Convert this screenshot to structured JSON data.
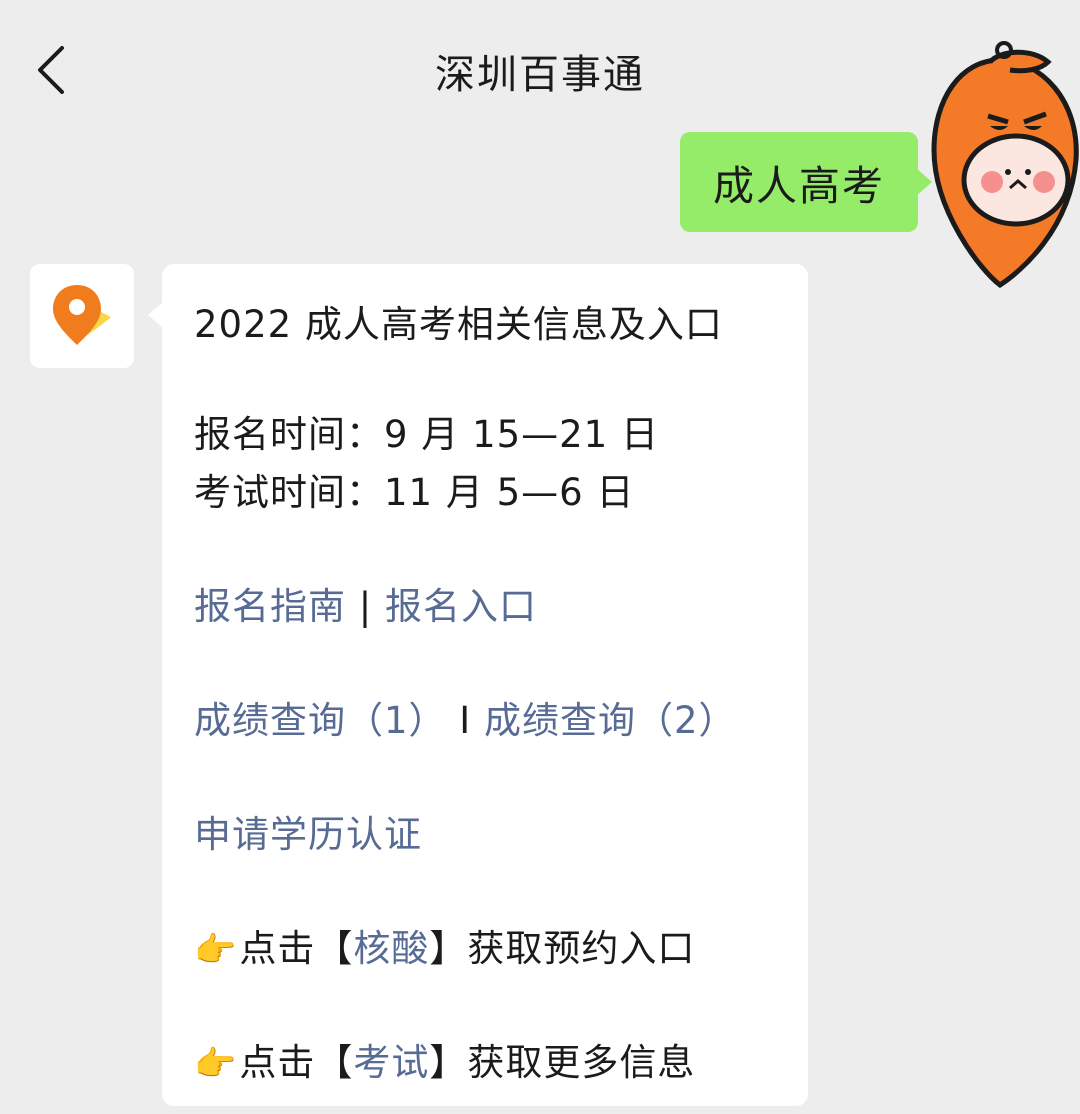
{
  "header": {
    "title": "深圳百事通"
  },
  "user_message": {
    "text": "成人高考"
  },
  "bot_message": {
    "headline": "2022 成人高考相关信息及入口",
    "registration_time": "报名时间：9 月 15—21 日",
    "exam_time": "考试时间：11 月 5—6 日",
    "links_row1": {
      "link1": "报名指南",
      "separator": " | ",
      "link2": "报名入口"
    },
    "links_row2": {
      "link1": "成绩查询（1）",
      "separator": " I ",
      "link2": "成绩查询（2）"
    },
    "links_row3": {
      "link1": "申请学历认证"
    },
    "promo1": {
      "emoji": "👉",
      "prefix": "点击【",
      "link": "核酸",
      "suffix": "】获取预约入口"
    },
    "promo2": {
      "emoji": "👉",
      "prefix": "点击【",
      "link": "考试",
      "suffix": "】获取更多信息"
    }
  },
  "colors": {
    "background": "#ededed",
    "user_bubble": "#95ec69",
    "bot_bubble": "#ffffff",
    "link": "#576b95",
    "pin_orange": "#f07c1e",
    "pin_yellow": "#f9d64a",
    "avatar_orange": "#f47a28"
  },
  "icons": {
    "back": "chevron-left-icon",
    "bot_avatar": "location-pin-icon",
    "user_avatar": "cartoon-avatar"
  }
}
